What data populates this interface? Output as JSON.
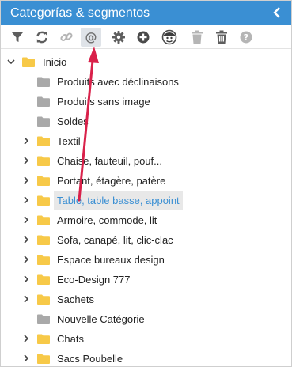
{
  "header": {
    "title": "Categorías & segmentos"
  },
  "toolbar": {
    "buttons": [
      "filter-icon",
      "refresh-icon",
      "link-icon",
      "at-icon",
      "gear-icon",
      "add-circle-icon",
      "user-avatar-icon",
      "trash-icon",
      "trash-full-icon",
      "help-icon"
    ],
    "active": "at-icon"
  },
  "tree": {
    "root": {
      "label": "Inicio",
      "expanded": true
    },
    "items": [
      {
        "label": "Produits avec déclinaisons",
        "has_children": false,
        "folder_color": "gray"
      },
      {
        "label": "Produits sans image",
        "has_children": false,
        "folder_color": "gray"
      },
      {
        "label": "Soldes",
        "has_children": false,
        "folder_color": "gray"
      },
      {
        "label": "Textil",
        "has_children": true,
        "folder_color": "yellow"
      },
      {
        "label": "Chaise, fauteuil, pouf...",
        "has_children": true,
        "folder_color": "yellow"
      },
      {
        "label": "Portant, étagère, patère",
        "has_children": true,
        "folder_color": "yellow"
      },
      {
        "label": "Table, table basse, appoint",
        "has_children": true,
        "folder_color": "yellow",
        "selected": true
      },
      {
        "label": "Armoire, commode, lit",
        "has_children": true,
        "folder_color": "yellow"
      },
      {
        "label": "Sofa, canapé, lit, clic-clac",
        "has_children": true,
        "folder_color": "yellow"
      },
      {
        "label": "Espace bureaux design",
        "has_children": true,
        "folder_color": "yellow"
      },
      {
        "label": "Eco-Design 777",
        "has_children": true,
        "folder_color": "yellow"
      },
      {
        "label": "Sachets",
        "has_children": true,
        "folder_color": "yellow"
      },
      {
        "label": "Nouvelle Catégorie",
        "has_children": false,
        "folder_color": "gray"
      },
      {
        "label": "Chats",
        "has_children": true,
        "folder_color": "yellow"
      },
      {
        "label": "Sacs Poubelle",
        "has_children": true,
        "folder_color": "yellow"
      }
    ]
  },
  "colors": {
    "header_bg": "#3a8fd3",
    "folder_yellow": "#f7c948",
    "folder_gray": "#a9a9a9",
    "selected_text": "#3a8fd3",
    "annotation_arrow": "#d9214a"
  }
}
